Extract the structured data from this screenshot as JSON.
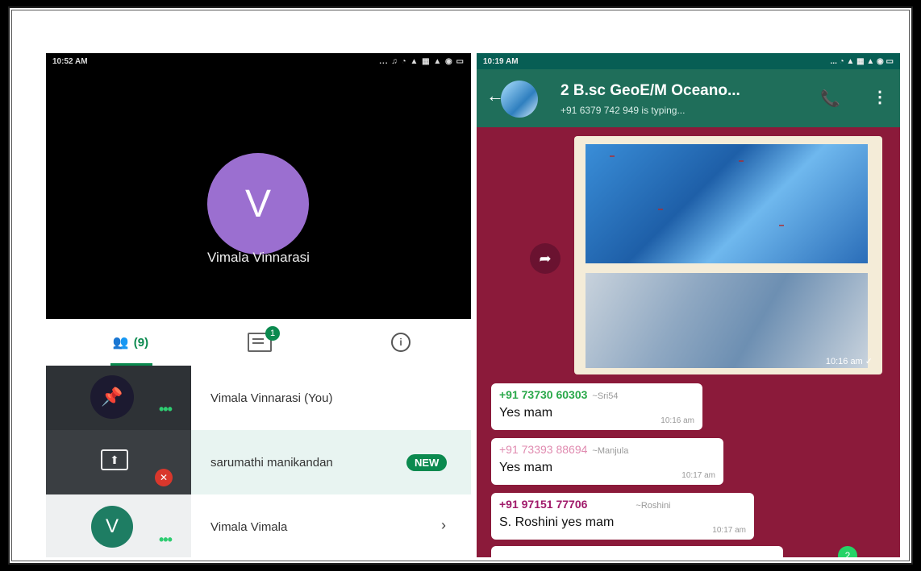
{
  "meet": {
    "status_time": "10:52 AM",
    "status_icons": "... ♫ ◔ ▲ ▦ ▲ ◉ ▭",
    "caller_initial": "V",
    "caller_name": "Vimala Vinnarasi",
    "tabs": {
      "people_label": "(9)",
      "chat_badge": "1",
      "info_symbol": "i"
    },
    "participants": [
      {
        "name": "Vimala Vinnarasi (You)"
      },
      {
        "name": "sarumathi manikandan",
        "badge": "NEW"
      },
      {
        "name": "Vimala Vimala",
        "initial": "V"
      }
    ]
  },
  "whatsapp": {
    "status_time": "10:19 AM",
    "status_icons": "... ◔ ▲ ▦ ▲ ◉ ▭",
    "group_title": "2 B.sc GeoE/M Oceano...",
    "typing_status": "+91 6379 742 949 is typing...",
    "image_time": "10:16 am ✓",
    "messages": [
      {
        "sender": "+91 73730 60303",
        "alias": "~Sri54",
        "text": "Yes mam",
        "time": "10:16 am",
        "color": "#2aa84a"
      },
      {
        "sender": "+91 73393 88694",
        "alias": "~Manjula",
        "text": "Yes mam",
        "time": "10:17 am",
        "color": "#e08bb0"
      },
      {
        "sender": "+91 97151 77706",
        "alias": "~Roshini",
        "text": "S. Roshini yes mam",
        "time": "10:17 am",
        "color": "#a01a6a"
      }
    ],
    "unread_count": "2"
  },
  "colors": {
    "meet_green": "#0b8a4f",
    "wa_header": "#1f6e5a",
    "chat_bg": "#8b1a3a"
  }
}
